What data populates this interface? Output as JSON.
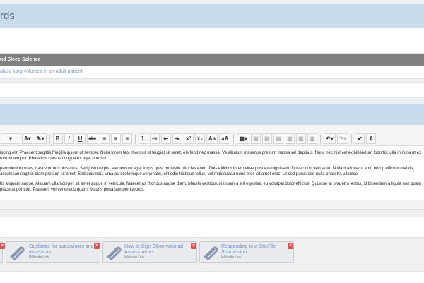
{
  "header": {
    "title": "rds"
  },
  "unit": {
    "title": "nd Sleep Science",
    "link_text": "alyse lung volumes in an adult patient"
  },
  "toolbar": {
    "font_color": "A",
    "bold": "B",
    "italic": "I",
    "underline": "U",
    "strike": "abc",
    "font_smaller": "Aa",
    "font_larger": "aA"
  },
  "editor": {
    "paragraphs": [
      "iscing elit. Praesent sagittis fringilla ipsum ut semper. Nulla lorem leo, rhoncus ut feugiat sit amet, eleifend nec massa. Vestibulum maximus pretium massa vel dapibus. Nunc nec nisl vel ex bibendum lobortis. ulla in nulla ut ex rutrum tempor. Phasellus cursus congue ex eget porttitor.",
      "parturient montes, nascetur ridiculus mus. Sed justo turpis, elementum eget turpis quis, molestie ultricies enim. Duis efficitur lorem vitae posuere dignissim. Donec non velit ante. Nullam aliquam, arcu non p efficitur mauris, accumsan sagittis diam pretium sit amet. Sed euismod, urna eu scelerisque venenatis, elit odio tristique tellus, vel malesuada nunc eros sit amet eros. Ut sed purus sed nulla pharetra ullamco",
      "tis aliquam augue. Aliquam ullamcorper sit amet augue in vehicula. Maecenas rhoncus augue diam. Mauris vestibulum ipsum a elit egestas, eu volutpat dolor efficitur. Quisque at pharetra lectus, id bibendum a ligula non quam placerat porttitor. Praesent vel venenatis quam. Mauris porta semper lobortis."
    ]
  },
  "resources": [
    {
      "title": "Guidance for supervisors and assessors",
      "type": "Website Link"
    },
    {
      "title": "How to Sign Observational Assessments",
      "type": "Website Link"
    },
    {
      "title": "Responding to a OneFile Submission",
      "type": "Website Link"
    }
  ],
  "colors": {
    "accent_band": "#c9dcee",
    "link": "#7a9cc6",
    "header_gray": "#808080",
    "remove": "#d9534f"
  }
}
